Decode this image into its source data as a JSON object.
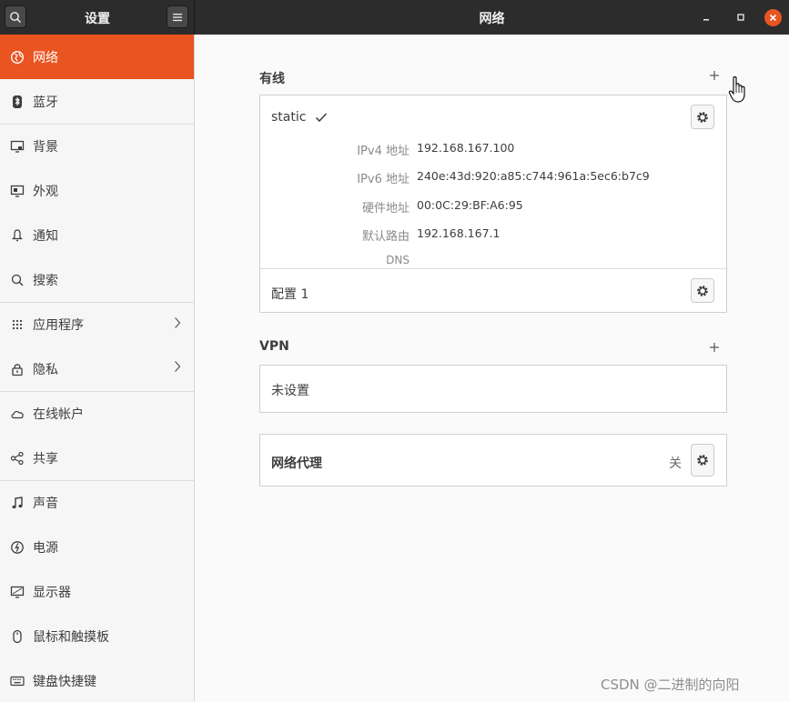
{
  "header": {
    "left_title": "设置",
    "title": "网络"
  },
  "sidebar": {
    "items": [
      {
        "label": "网络",
        "icon": "network-globe-icon"
      },
      {
        "label": "蓝牙",
        "icon": "bluetooth-icon"
      },
      {
        "label": "背景",
        "icon": "background-monitor-icon"
      },
      {
        "label": "外观",
        "icon": "appearance-icon"
      },
      {
        "label": "通知",
        "icon": "bell-icon"
      },
      {
        "label": "搜索",
        "icon": "search-icon"
      },
      {
        "label": "应用程序",
        "icon": "apps-grid-icon"
      },
      {
        "label": "隐私",
        "icon": "lock-icon"
      },
      {
        "label": "在线帐户",
        "icon": "cloud-icon"
      },
      {
        "label": "共享",
        "icon": "share-icon"
      },
      {
        "label": "声音",
        "icon": "music-note-icon"
      },
      {
        "label": "电源",
        "icon": "power-icon"
      },
      {
        "label": "显示器",
        "icon": "display-icon"
      },
      {
        "label": "鼠标和触摸板",
        "icon": "mouse-icon"
      },
      {
        "label": "键盘快捷键",
        "icon": "keyboard-icon"
      }
    ]
  },
  "wired": {
    "title": "有线",
    "connection_name": "static",
    "details": {
      "ipv4_label": "IPv4 地址",
      "ipv4_value": "192.168.167.100",
      "ipv6_label": "IPv6 地址",
      "ipv6_value": "240e:43d:920:a85:c744:961a:5ec6:b7c9",
      "hw_label": "硬件地址",
      "hw_value": "00:0C:29:BF:A6:95",
      "route_label": "默认路由",
      "route_value": "192.168.167.1",
      "dns_label": "DNS"
    },
    "profile_name": "配置 1"
  },
  "vpn": {
    "title": "VPN",
    "empty_label": "未设置"
  },
  "proxy": {
    "title": "网络代理",
    "status": "关"
  },
  "watermark": "CSDN @二进制的向阳"
}
